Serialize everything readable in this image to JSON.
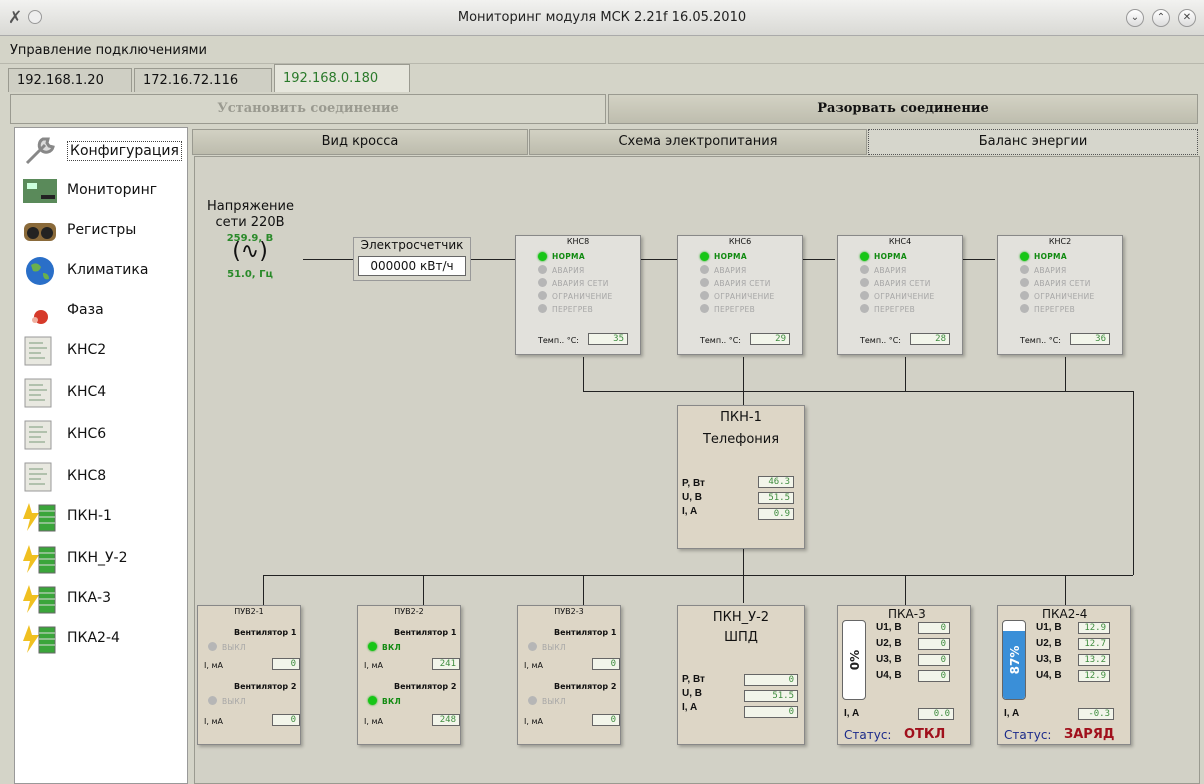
{
  "window": {
    "title": "Мониторинг модуля МСК 2.21f 16.05.2010"
  },
  "menu": {
    "connections": "Управление подключениями"
  },
  "ip_tabs": [
    "192.168.1.20",
    "172.16.72.116",
    "192.168.0.180"
  ],
  "connection": {
    "connect": "Установить соединение",
    "disconnect": "Разорвать соединение"
  },
  "sidebar": {
    "items": [
      {
        "label": "Конфигурация",
        "icon": "wrench-icon"
      },
      {
        "label": "Мониторинг",
        "icon": "board-icon"
      },
      {
        "label": "Регистры",
        "icon": "binoculars-icon"
      },
      {
        "label": "Климатика",
        "icon": "globe-icon"
      },
      {
        "label": "Фаза",
        "icon": "phase-icon"
      },
      {
        "label": "КНС2",
        "icon": "doc-icon"
      },
      {
        "label": "КНС4",
        "icon": "doc-icon"
      },
      {
        "label": "КНС6",
        "icon": "doc-icon"
      },
      {
        "label": "КНС8",
        "icon": "doc-icon"
      },
      {
        "label": "ПКН-1",
        "icon": "battery-icon"
      },
      {
        "label": "ПКН_У-2",
        "icon": "battery-icon"
      },
      {
        "label": "ПКА-3",
        "icon": "battery-icon"
      },
      {
        "label": "ПКА2-4",
        "icon": "battery-icon"
      }
    ]
  },
  "view_tabs": [
    "Вид кросса",
    "Схема электропитания",
    "Баланс энергии"
  ],
  "mains": {
    "title1": "Напряжение",
    "title2": "сети 220В",
    "voltage": "259.9, В",
    "freq": "51.0, Гц",
    "symbol": "(∿)"
  },
  "meter": {
    "title": "Электросчетчик",
    "value": "000000 кВт/ч"
  },
  "status_labels": [
    "НОРМА",
    "АВАРИЯ",
    "АВАРИЯ СЕТИ",
    "ОГРАНИЧЕНИЕ",
    "ПЕРЕГРЕВ"
  ],
  "temp_label": "Темп.. °С:",
  "kns": [
    {
      "name": "КНС8",
      "temp": "35"
    },
    {
      "name": "КНС6",
      "temp": "29"
    },
    {
      "name": "КНС4",
      "temp": "28"
    },
    {
      "name": "КНС2",
      "temp": "36"
    }
  ],
  "pkn1": {
    "name": "ПКН-1",
    "sub": "Телефония",
    "p_label": "P, Вт",
    "u_label": "U, B",
    "i_label": "I, A",
    "p": "46.3",
    "u": "51.5",
    "i": "0.9"
  },
  "puv": [
    {
      "name": "ПУВ2-1",
      "fan1": "Вентилятор 1",
      "fan2": "Вентилятор 2",
      "s1": "ВЫКЛ",
      "s2": "ВЫКЛ",
      "on1": false,
      "on2": false,
      "i1": "0",
      "i2": "0"
    },
    {
      "name": "ПУВ2-2",
      "fan1": "Вентилятор 1",
      "fan2": "Вентилятор 2",
      "s1": "ВКЛ",
      "s2": "ВКЛ",
      "on1": true,
      "on2": true,
      "i1": "241",
      "i2": "248"
    },
    {
      "name": "ПУВ2-3",
      "fan1": "Вентилятор 1",
      "fan2": "Вентилятор 2",
      "s1": "ВЫКЛ",
      "s2": "ВЫКЛ",
      "on1": false,
      "on2": false,
      "i1": "0",
      "i2": "0"
    }
  ],
  "i_ma_label": "I, мА",
  "pkn_u2": {
    "name": "ПКН_У-2",
    "sub": "ШПД",
    "p_label": "P, Вт",
    "u_label": "U, B",
    "i_label": "I, A",
    "p": "0",
    "u": "51.5",
    "i": "0"
  },
  "pka3": {
    "name": "ПКА-3",
    "charge": "0%",
    "charge_fraction": 0.0,
    "u1": "0",
    "u2": "0",
    "u3": "0",
    "u4": "0",
    "i": "0.0",
    "status_label": "Статус:",
    "status": "ОТКЛ"
  },
  "pka24": {
    "name": "ПКА2-4",
    "charge": "87%",
    "charge_fraction": 0.87,
    "u1": "12.9",
    "u2": "12.7",
    "u3": "13.2",
    "u4": "12.9",
    "i": "-0.3",
    "status_label": "Статус:",
    "status": "ЗАРЯД"
  },
  "u_labels": [
    "U1, B",
    "U2, B",
    "U3, B",
    "U4, B"
  ],
  "i_a_label": "I, A",
  "colors": {
    "led_on": "#17c617",
    "status_red": "#a0101c",
    "battery_fill": "#3a8fd8",
    "green_text": "#2a7a2a"
  }
}
